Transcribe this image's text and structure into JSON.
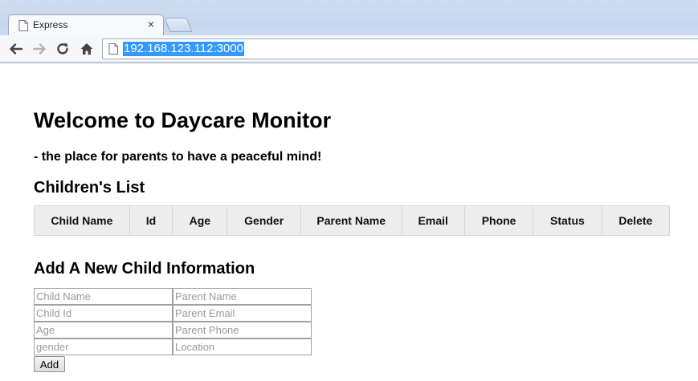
{
  "browser": {
    "tab_title": "Express",
    "tab_close_glyph": "×",
    "address": "192.168.123.112:3000",
    "icons": [
      "document-icon",
      "back-arrow-icon",
      "forward-arrow-icon",
      "reload-icon",
      "home-icon",
      "close-icon"
    ]
  },
  "page": {
    "title": "Welcome to Daycare Monitor",
    "tagline": "- the place for parents to have a peaceful mind!",
    "list_heading": "Children's List",
    "table_headers": [
      "Child Name",
      "Id",
      "Age",
      "Gender",
      "Parent Name",
      "Email",
      "Phone",
      "Status",
      "Delete"
    ],
    "add_heading": "Add A New Child Information",
    "form": {
      "child_name_placeholder": "Child Name",
      "parent_name_placeholder": "Parent Name",
      "child_id_placeholder": "Child Id",
      "parent_email_placeholder": "Parent Email",
      "age_placeholder": "Age",
      "parent_phone_placeholder": "Parent Phone",
      "gender_placeholder": "gender",
      "location_placeholder": "Location",
      "add_label": "Add"
    }
  },
  "colors": {
    "selection_highlight": "#3399ff",
    "table_header_bg": "#ededed"
  }
}
